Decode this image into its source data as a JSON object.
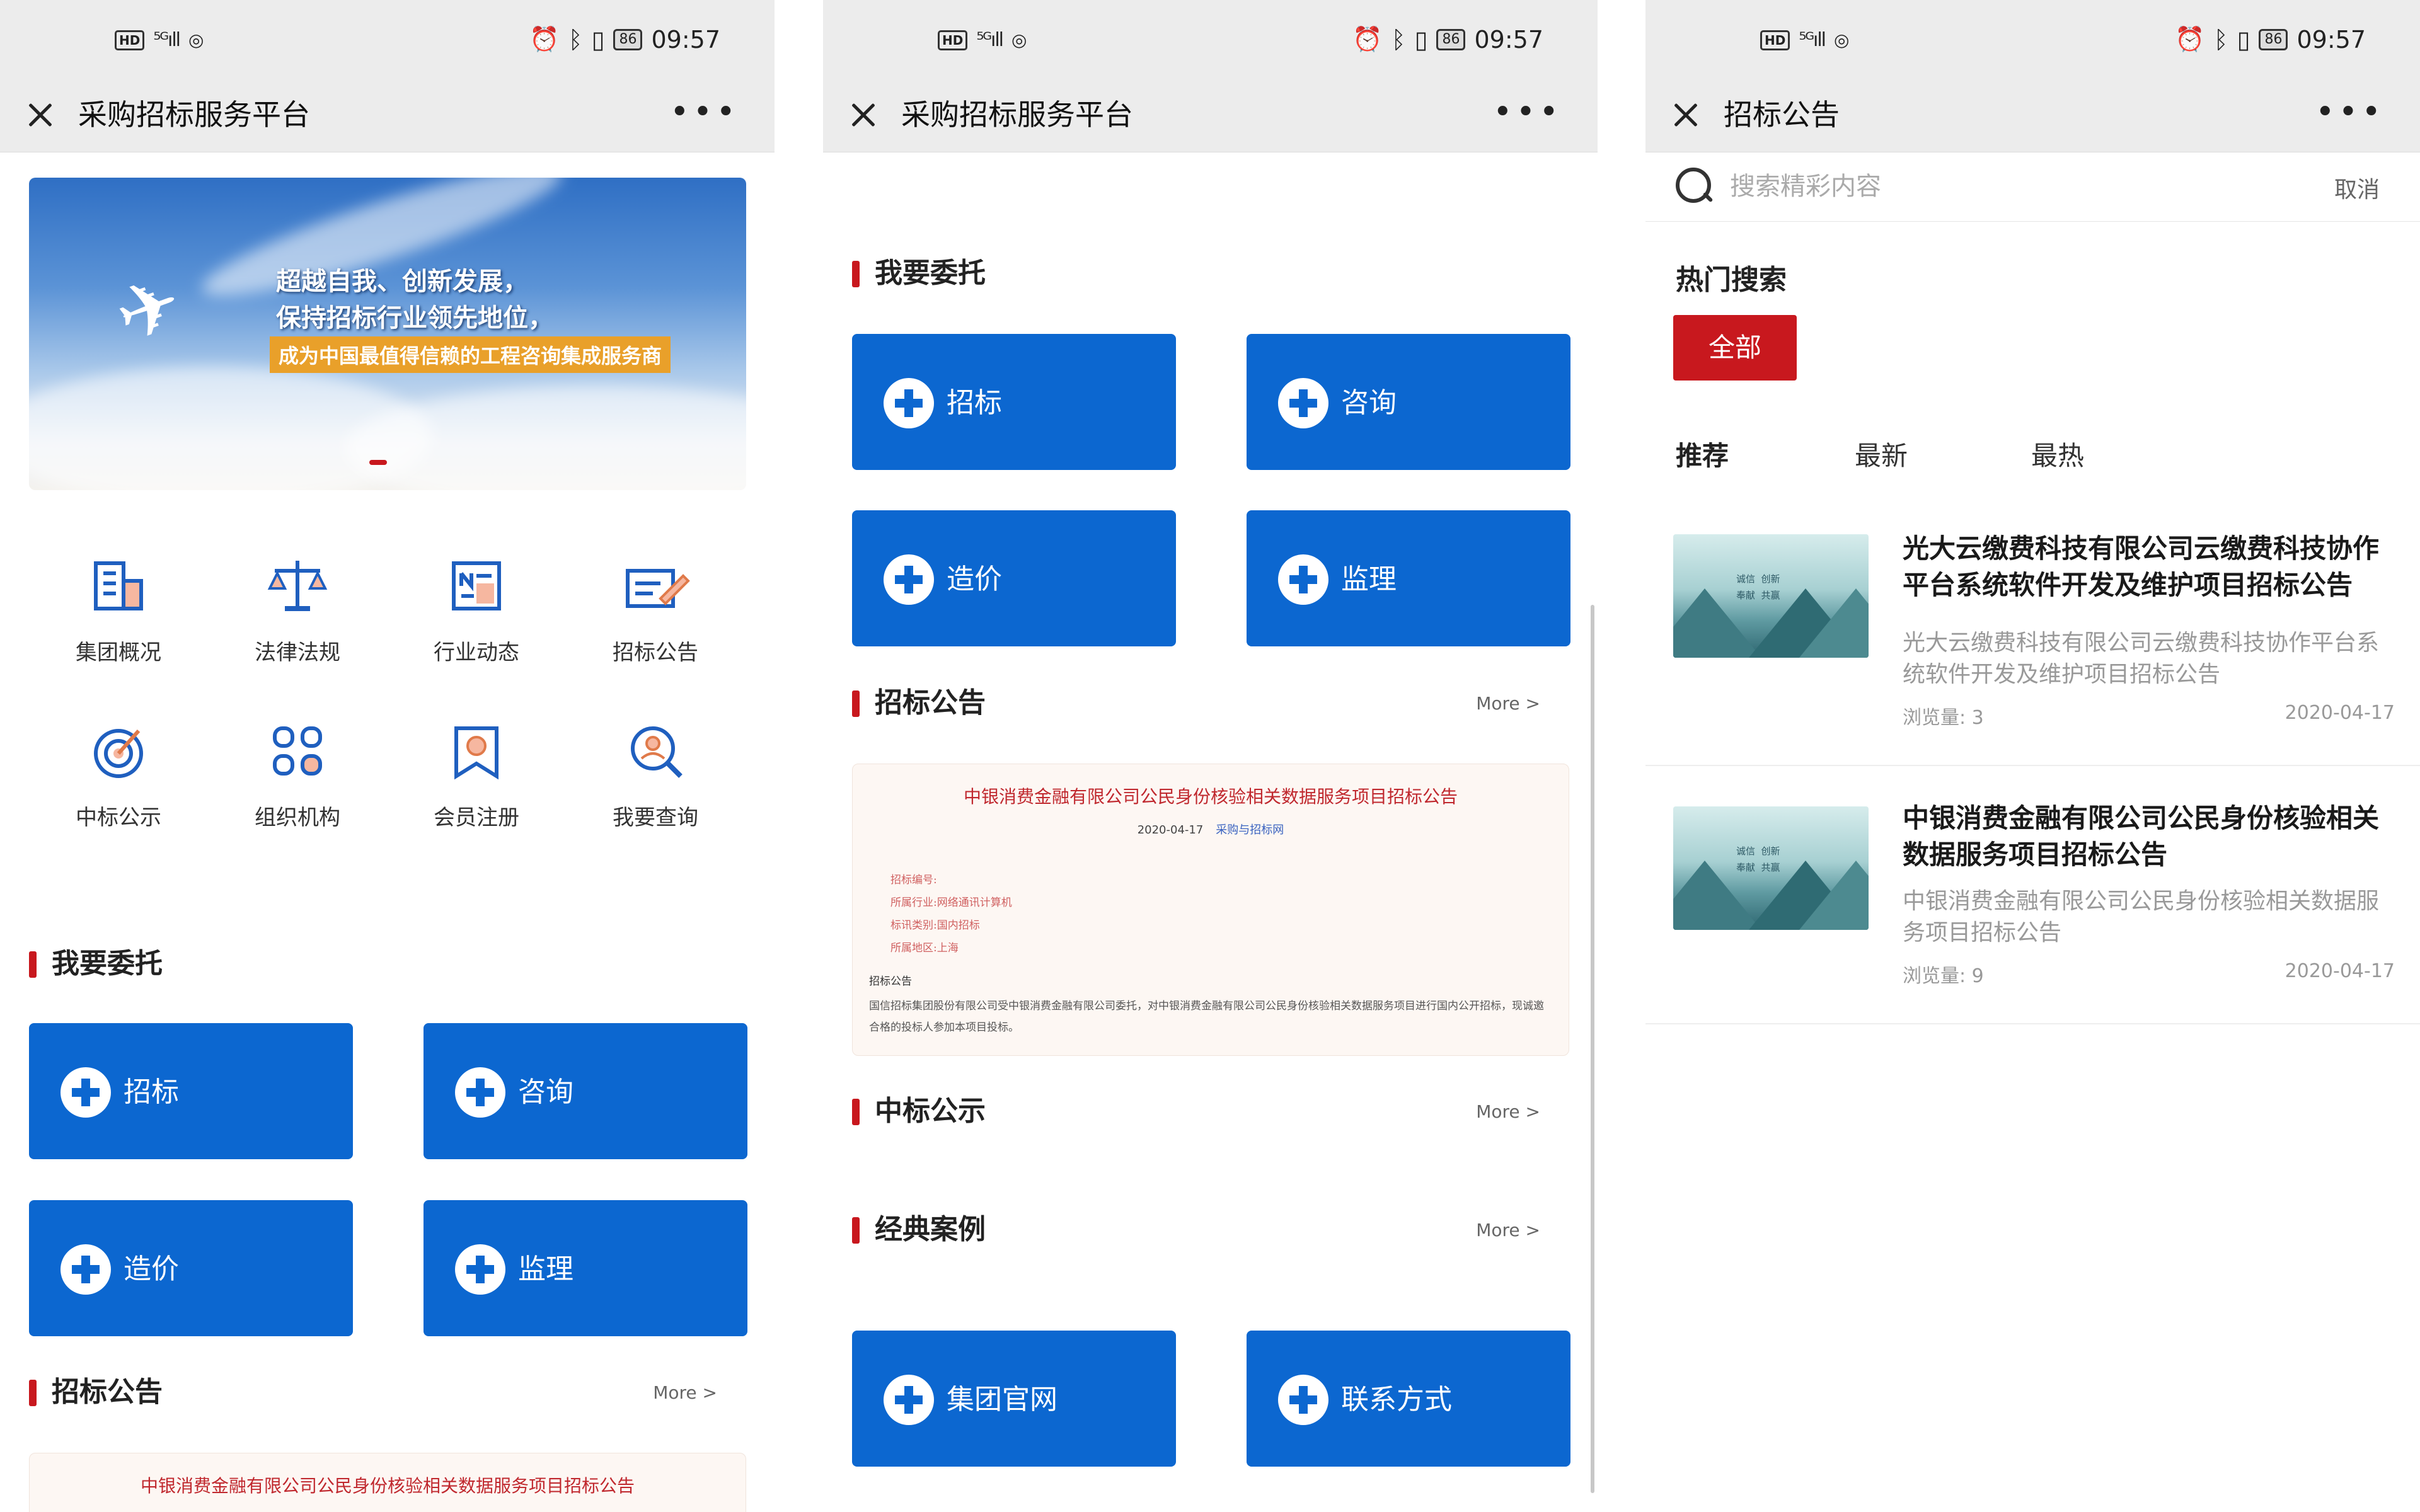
{
  "status": {
    "time": "09:57",
    "battery": "86",
    "network": "5G",
    "hd": "HD"
  },
  "screen1": {
    "nav_title": "采购招标服务平台",
    "banner": {
      "line1": "超越自我、创新发展，",
      "line2": "保持招标行业领先地位，",
      "line3": "成为中国最值得信赖的工程咨询集成服务商"
    },
    "grid": [
      {
        "label": "集团概况",
        "icon": "building-icon"
      },
      {
        "label": "法律法规",
        "icon": "scales-icon"
      },
      {
        "label": "行业动态",
        "icon": "news-icon"
      },
      {
        "label": "招标公告",
        "icon": "announcement-icon"
      },
      {
        "label": "中标公示",
        "icon": "target-icon"
      },
      {
        "label": "组织机构",
        "icon": "organization-icon"
      },
      {
        "label": "会员注册",
        "icon": "member-badge-icon"
      },
      {
        "label": "我要查询",
        "icon": "query-icon"
      }
    ],
    "section_entrust": "我要委托",
    "tiles": [
      "招标",
      "咨询",
      "造价",
      "监理"
    ],
    "section_notice": "招标公告",
    "more": "More >",
    "notice_title": "中银消费金融有限公司公民身份核验相关数据服务项目招标公告"
  },
  "screen2": {
    "nav_title": "采购招标服务平台",
    "section_entrust": "我要委托",
    "tiles": [
      "招标",
      "咨询",
      "造价",
      "监理"
    ],
    "section_notice": "招标公告",
    "more": "More >",
    "notice": {
      "title": "中银消费金融有限公司公民身份核验相关数据服务项目招标公告",
      "date": "2020-04-17",
      "source": "采购与招标网",
      "lines": [
        "招标编号:",
        "所属行业:网络通讯计算机",
        "标讯类别:国内招标",
        "所属地区:上海"
      ],
      "sub": "招标公告",
      "body": "国信招标集团股份有限公司受中银消费金融有限公司委托，对中银消费金融有限公司公民身份核验相关数据服务项目进行国内公开招标，现诚邀合格的投标人参加本项目投标。"
    },
    "section_award": "中标公示",
    "section_cases": "经典案例",
    "bottom_tiles": [
      "集团官网",
      "联系方式"
    ]
  },
  "screen3": {
    "nav_title": "招标公告",
    "search_placeholder": "搜索精彩内容",
    "cancel": "取消",
    "hot_title": "热门搜索",
    "hot_chip": "全部",
    "tabs": [
      "推荐",
      "最新",
      "最热"
    ],
    "articles": [
      {
        "title": "光大云缴费科技有限公司云缴费科技协作平台系统软件开发及维护项目招标公告",
        "desc": "光大云缴费科技有限公司云缴费科技协作平台系统软件开发及维护项目招标公告",
        "views": "浏览量: 3",
        "date": "2020-04-17",
        "thumb_text": "诚信  创新\n奉献  共赢"
      },
      {
        "title": "中银消费金融有限公司公民身份核验相关数据服务项目招标公告",
        "desc": "中银消费金融有限公司公民身份核验相关数据服务项目招标公告",
        "views": "浏览量: 9",
        "date": "2020-04-17",
        "thumb_text": "诚信  创新\n奉献  共赢"
      }
    ]
  },
  "colors": {
    "primary_blue": "#0c67d0",
    "accent_red": "#c8181e",
    "bar_gray": "#ececec"
  }
}
